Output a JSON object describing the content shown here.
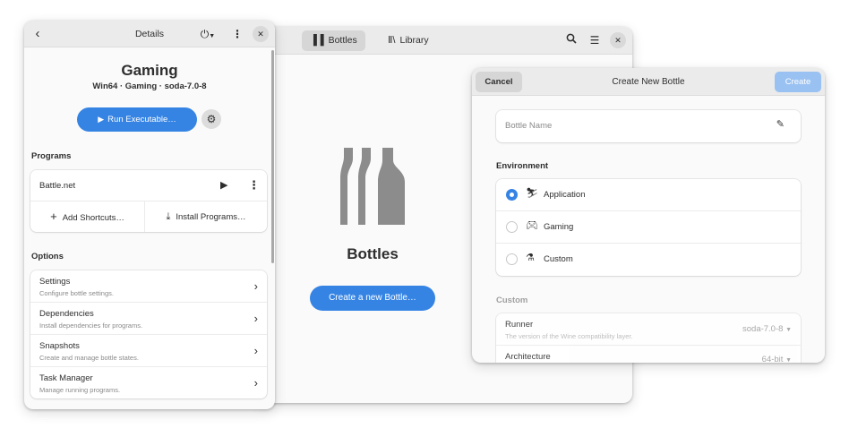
{
  "main": {
    "tabs": [
      {
        "label": "Bottles",
        "icon": "bottles-tab-icon",
        "active": true
      },
      {
        "label": "Library",
        "icon": "library-icon",
        "active": false
      }
    ],
    "title": "Bottles",
    "create_button": "Create a new Bottle…"
  },
  "details": {
    "title": "Details",
    "bottle": {
      "name": "Gaming",
      "meta": "Win64 · Gaming · soda-7.0-8"
    },
    "run_button": "Run Executable…",
    "programs_label": "Programs",
    "program": {
      "name": "Battle.net"
    },
    "add_shortcuts": "Add Shortcuts…",
    "install_programs": "Install Programs…",
    "options_label": "Options",
    "options": [
      {
        "title": "Settings",
        "subtitle": "Configure bottle settings."
      },
      {
        "title": "Dependencies",
        "subtitle": "Install dependencies for programs."
      },
      {
        "title": "Snapshots",
        "subtitle": "Create and manage bottle states."
      },
      {
        "title": "Task Manager",
        "subtitle": "Manage running programs."
      }
    ]
  },
  "dialog": {
    "cancel": "Cancel",
    "title": "Create New Bottle",
    "create": "Create",
    "name_placeholder": "Bottle Name",
    "environment_label": "Environment",
    "environments": [
      {
        "label": "Application",
        "icon": "application-icon",
        "selected": true
      },
      {
        "label": "Gaming",
        "icon": "gamepad-icon",
        "selected": false
      },
      {
        "label": "Custom",
        "icon": "flask-icon",
        "selected": false
      }
    ],
    "custom_label": "Custom",
    "runner": {
      "title": "Runner",
      "subtitle": "The version of the Wine compatibility layer.",
      "value": "soda-7.0-8"
    },
    "architecture": {
      "title": "Architecture",
      "value": "64-bit"
    }
  },
  "colors": {
    "accent": "#3584e4",
    "accent_disabled": "#99c1f1"
  }
}
